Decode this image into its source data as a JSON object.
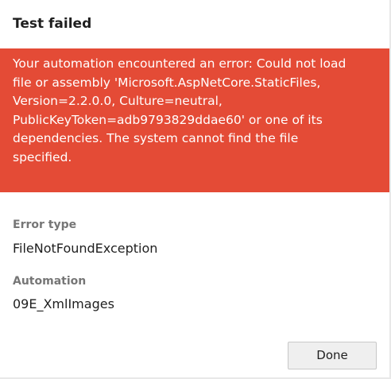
{
  "dialog": {
    "title": "Test failed",
    "error_message": "Your automation encountered an error: Could not load file or assembly 'Microsoft.AspNetCore.StaticFiles, Version=2.2.0.0, Culture=neutral, PublicKeyToken=adb9793829ddae60' or one of its dependencies. The system cannot find the file specified.",
    "error_type_label": "Error type",
    "error_type_value": "FileNotFoundException",
    "automation_label": "Automation",
    "automation_value": "09E_XmlImages",
    "done_label": "Done"
  },
  "colors": {
    "error_background": "#e44b36",
    "text_primary": "#1f1f1f",
    "text_label": "#767676",
    "button_background": "#efefef"
  }
}
